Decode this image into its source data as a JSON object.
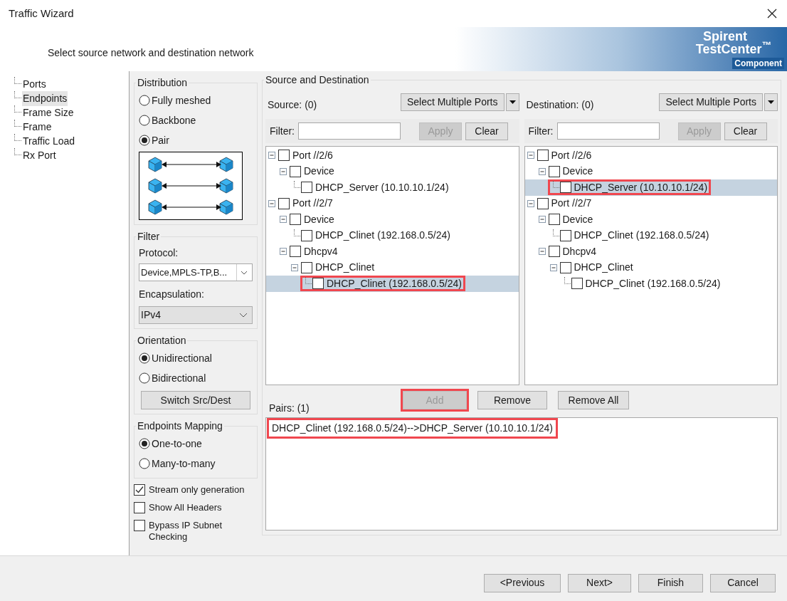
{
  "window": {
    "title": "Traffic Wizard"
  },
  "header": {
    "subtitle": "Select source network and destination network",
    "logo_line1": "Spirent",
    "logo_line2": "TestCenter$^{™}$",
    "logo_tag": "Component"
  },
  "nav": [
    {
      "label": "Ports",
      "selected": false
    },
    {
      "label": "Endpoints",
      "selected": true
    },
    {
      "label": "Frame Size",
      "selected": false
    },
    {
      "label": "Frame",
      "selected": false
    },
    {
      "label": "Traffic Load",
      "selected": false
    },
    {
      "label": "Rx Port",
      "selected": false
    }
  ],
  "distribution": {
    "title": "Distribution",
    "options": [
      {
        "label": "Fully meshed",
        "selected": false
      },
      {
        "label": "Backbone",
        "selected": false
      },
      {
        "label": "Pair",
        "selected": true
      }
    ]
  },
  "filter": {
    "title": "Filter",
    "protocol_label": "Protocol:",
    "protocol_value": "Device,MPLS-TP,B...",
    "encapsulation_label": "Encapsulation:",
    "encapsulation_value": "IPv4"
  },
  "orientation": {
    "title": "Orientation",
    "options": [
      {
        "label": "Unidirectional",
        "selected": true
      },
      {
        "label": "Bidirectional",
        "selected": false
      }
    ],
    "switch_button": "Switch Src/Dest"
  },
  "mapping": {
    "title": "Endpoints Mapping",
    "options": [
      {
        "label": "One-to-one",
        "selected": true
      },
      {
        "label": "Many-to-many",
        "selected": false
      }
    ]
  },
  "checkboxes": [
    {
      "label": "Stream only generation",
      "checked": true
    },
    {
      "label": "Show All Headers",
      "checked": false
    },
    {
      "label": "Bypass IP Subnet Checking",
      "checked": false
    }
  ],
  "source_destination": {
    "title": "Source and Destination",
    "panels": [
      {
        "label": "Source: (0)",
        "select_button": "Select Multiple Ports",
        "filter_label": "Filter:",
        "apply_button": {
          "label": "Apply",
          "disabled": true
        },
        "clear_button": "Clear",
        "tree": [
          {
            "label": "Port //2/6",
            "checked": false,
            "selected": false,
            "highlighted": false,
            "children": [
              {
                "label": "Device",
                "checked": false,
                "selected": false,
                "highlighted": false,
                "children": [
                  {
                    "label": "DHCP_Server (10.10.10.1/24)",
                    "checked": false,
                    "selected": false,
                    "highlighted": false
                  }
                ]
              }
            ]
          },
          {
            "label": "Port //2/7",
            "checked": false,
            "selected": false,
            "highlighted": false,
            "children": [
              {
                "label": "Device",
                "checked": false,
                "selected": false,
                "highlighted": false,
                "children": [
                  {
                    "label": "DHCP_Clinet (192.168.0.5/24)",
                    "checked": false,
                    "selected": false,
                    "highlighted": false
                  }
                ]
              },
              {
                "label": "Dhcpv4",
                "checked": false,
                "selected": false,
                "highlighted": false,
                "children": [
                  {
                    "label": "DHCP_Clinet",
                    "checked": false,
                    "selected": false,
                    "highlighted": false,
                    "children": [
                      {
                        "label": "DHCP_Clinet (192.168.0.5/24)",
                        "checked": false,
                        "selected": true,
                        "highlighted": true
                      }
                    ]
                  }
                ]
              }
            ]
          }
        ]
      },
      {
        "label": "Destination: (0)",
        "select_button": "Select Multiple Ports",
        "filter_label": "Filter:",
        "apply_button": {
          "label": "Apply",
          "disabled": true
        },
        "clear_button": "Clear",
        "tree": [
          {
            "label": "Port //2/6",
            "checked": false,
            "selected": false,
            "highlighted": false,
            "children": [
              {
                "label": "Device",
                "checked": false,
                "selected": false,
                "highlighted": false,
                "children": [
                  {
                    "label": "DHCP_Server (10.10.10.1/24)",
                    "checked": false,
                    "selected": true,
                    "highlighted": true
                  }
                ]
              }
            ]
          },
          {
            "label": "Port //2/7",
            "checked": false,
            "selected": false,
            "highlighted": false,
            "children": [
              {
                "label": "Device",
                "checked": false,
                "selected": false,
                "highlighted": false,
                "children": [
                  {
                    "label": "DHCP_Clinet (192.168.0.5/24)",
                    "checked": false,
                    "selected": false,
                    "highlighted": false
                  }
                ]
              },
              {
                "label": "Dhcpv4",
                "checked": false,
                "selected": false,
                "highlighted": false,
                "children": [
                  {
                    "label": "DHCP_Clinet",
                    "checked": false,
                    "selected": false,
                    "highlighted": false,
                    "children": [
                      {
                        "label": "DHCP_Clinet (192.168.0.5/24)",
                        "checked": false,
                        "selected": false,
                        "highlighted": false
                      }
                    ]
                  }
                ]
              }
            ]
          }
        ]
      }
    ]
  },
  "pairs": {
    "label": "Pairs: (1)",
    "buttons": [
      {
        "label": "Add",
        "disabled": true,
        "highlighted": true
      },
      {
        "label": "Remove",
        "disabled": false,
        "highlighted": false
      },
      {
        "label": "Remove All",
        "disabled": false,
        "highlighted": false
      }
    ],
    "items": [
      {
        "text": "DHCP_Clinet (192.168.0.5/24)-->DHCP_Server (10.10.10.1/24)",
        "highlighted": true
      }
    ]
  },
  "footer_buttons": [
    "<Previous",
    "Next>",
    "Finish",
    "Cancel"
  ]
}
